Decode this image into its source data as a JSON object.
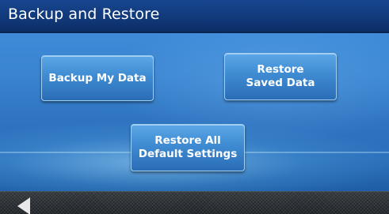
{
  "window": {
    "title": "Backup and Restore"
  },
  "buttons": {
    "backup_label": "Backup My Data",
    "restore_saved_label": "Restore\nSaved Data",
    "restore_defaults_label": "Restore All\nDefault Settings"
  },
  "nav": {
    "back_icon": "back-arrow-icon"
  },
  "colors": {
    "title_bar": "#11397a",
    "content_bg": "#3a84d1",
    "button_fill": "#3f8bd2",
    "button_border": "#9fd0f2",
    "bottom_bar": "#2a2f33",
    "text": "#ffffff"
  }
}
